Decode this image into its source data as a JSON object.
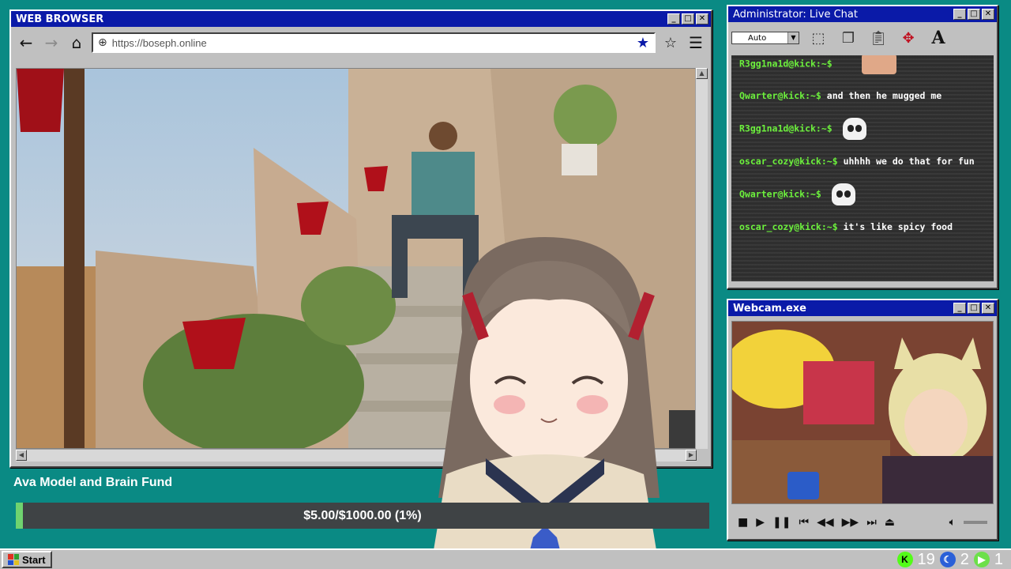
{
  "browser": {
    "title": "WEB BROWSER",
    "url": "https://boseph.online"
  },
  "chat": {
    "title": "Administrator: Live Chat",
    "font_select": "Auto",
    "messages": [
      {
        "user": "R3gg1na1d@kick:~$",
        "text": "",
        "emote": "face"
      },
      {
        "user": "Qwarter@kick:~$",
        "text": "and then he mugged me",
        "emote": ""
      },
      {
        "user": "R3gg1na1d@kick:~$",
        "text": "",
        "emote": "skull"
      },
      {
        "user": "oscar_cozy@kick:~$",
        "text": "uhhhh we do that for fun",
        "emote": ""
      },
      {
        "user": "Qwarter@kick:~$",
        "text": "",
        "emote": "skull"
      },
      {
        "user": "oscar_cozy@kick:~$",
        "text": "it's like spicy food",
        "emote": ""
      }
    ]
  },
  "webcam": {
    "title": "Webcam.exe"
  },
  "fund": {
    "title": "Ava Model and Brain Fund",
    "amount": "$5.00/$1000.00 (1%)",
    "progress_fraction": 0.01
  },
  "taskbar": {
    "start_label": "Start",
    "count_a": "19",
    "count_b": "2",
    "count_c": "1"
  },
  "colors": {
    "desktop": "#0a8a84",
    "titlebar": "#0a1aa8",
    "chat_user": "#6cf03c",
    "fund_bar": "#3f4345"
  }
}
